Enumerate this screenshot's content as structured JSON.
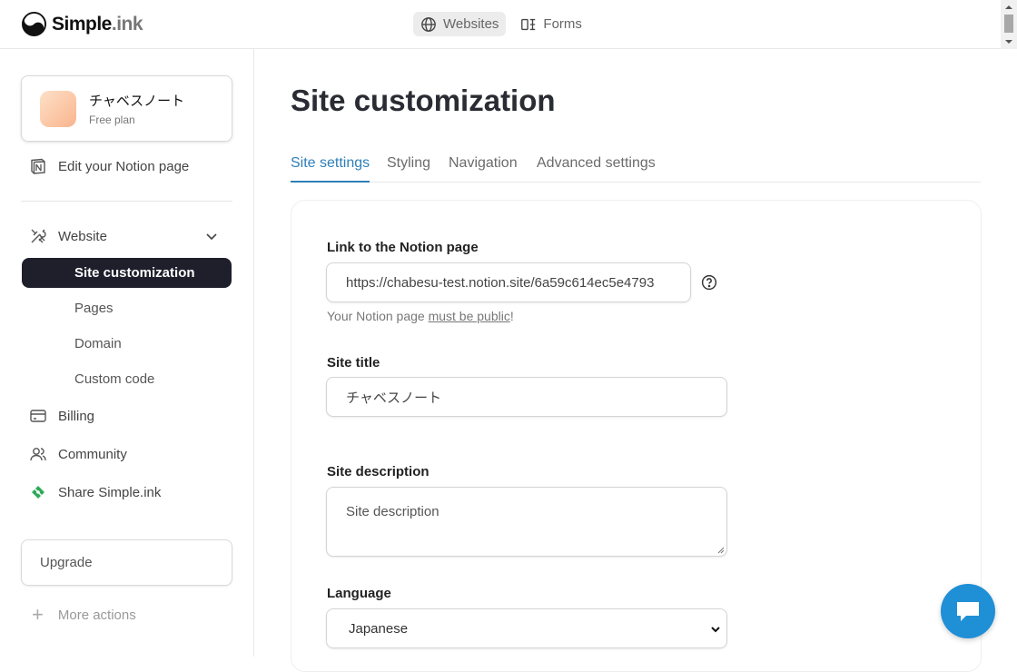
{
  "brand": {
    "name": "Simple",
    "suffix": ".ink"
  },
  "topnav": {
    "websites": "Websites",
    "forms": "Forms"
  },
  "sidebar": {
    "site": {
      "name": "チャベスノート",
      "plan": "Free plan"
    },
    "edit_notion": "Edit your Notion page",
    "website": "Website",
    "sub_items": [
      "Site customization",
      "Pages",
      "Domain",
      "Custom code"
    ],
    "billing": "Billing",
    "community": "Community",
    "share": "Share Simple.ink",
    "upgrade": "Upgrade",
    "more_actions": "More actions"
  },
  "main": {
    "title": "Site customization",
    "tabs": [
      "Site settings",
      "Styling",
      "Navigation",
      "Advanced settings"
    ],
    "notion_link": {
      "label": "Link to the Notion page",
      "value": "https://chabesu-test.notion.site/6a59c614ec5e4793",
      "helper_prefix": "Your Notion page ",
      "helper_link": "must be public",
      "helper_suffix": "!"
    },
    "site_title": {
      "label": "Site title",
      "value": "チャベスノート"
    },
    "site_description": {
      "label": "Site description",
      "placeholder": "Site description"
    },
    "language": {
      "label": "Language",
      "value": "Japanese"
    }
  },
  "colors": {
    "accent": "#2f7fb8",
    "active_nav": "#1e1f2b",
    "chat": "#1f8fd6"
  }
}
